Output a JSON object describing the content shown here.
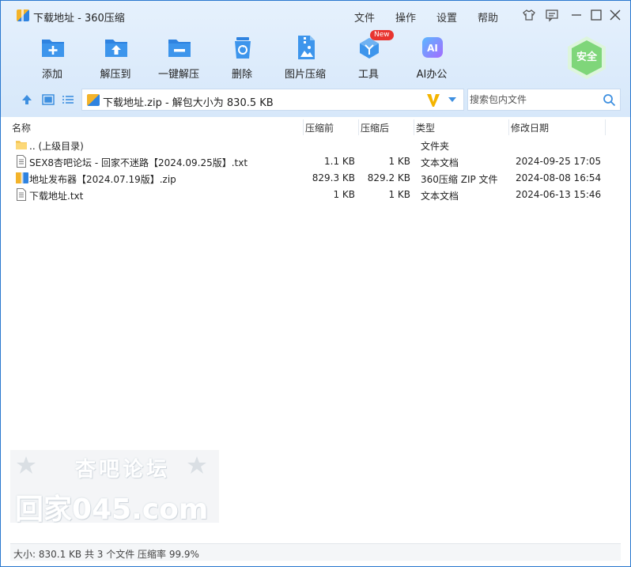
{
  "window": {
    "title": "下载地址 - 360压缩"
  },
  "menu": {
    "file": "文件",
    "operate": "操作",
    "settings": "设置",
    "help": "帮助"
  },
  "toolbar": {
    "add": "添加",
    "extract_to": "解压到",
    "one_click_extract": "一键解压",
    "delete": "删除",
    "image_compress": "图片压缩",
    "tools": "工具",
    "tools_badge": "New",
    "ai_office": "AI办公",
    "ai_icon_text": "AI",
    "safe": "安全"
  },
  "address": {
    "path": "下载地址.zip - 解包大小为 830.5 KB"
  },
  "search": {
    "placeholder": "搜索包内文件"
  },
  "columns": {
    "name": "名称",
    "before": "压缩前",
    "after": "压缩后",
    "type": "类型",
    "modified": "修改日期"
  },
  "files": [
    {
      "name": ".. (上级目录)",
      "before": "",
      "after": "",
      "type": "文件夹",
      "modified": "",
      "icon": "folder-icon"
    },
    {
      "name": "SEX8杏吧论坛 - 回家不迷路【2024.09.25版】.txt",
      "before": "1.1 KB",
      "after": "1 KB",
      "type": "文本文档",
      "modified": "2024-09-25 17:05",
      "icon": "text-file-icon"
    },
    {
      "name": "地址发布器【2024.07.19版】.zip",
      "before": "829.3 KB",
      "after": "829.2 KB",
      "type": "360压缩 ZIP 文件",
      "modified": "2024-08-08 16:54",
      "icon": "zip-file-icon"
    },
    {
      "name": "下载地址.txt",
      "before": "1 KB",
      "after": "1 KB",
      "type": "文本文档",
      "modified": "2024-06-13 15:46",
      "icon": "text-file-icon"
    }
  ],
  "watermark": {
    "line1": "杏吧论坛",
    "line2": "回家045.com"
  },
  "status": {
    "text": "大小: 830.1 KB 共 3 个文件 压缩率 99.9%"
  },
  "colors": {
    "accent": "#2f83e0",
    "toolbar_bg": "#dcebfb",
    "safe_green": "#7fd67a",
    "badge_red": "#e8342f"
  }
}
